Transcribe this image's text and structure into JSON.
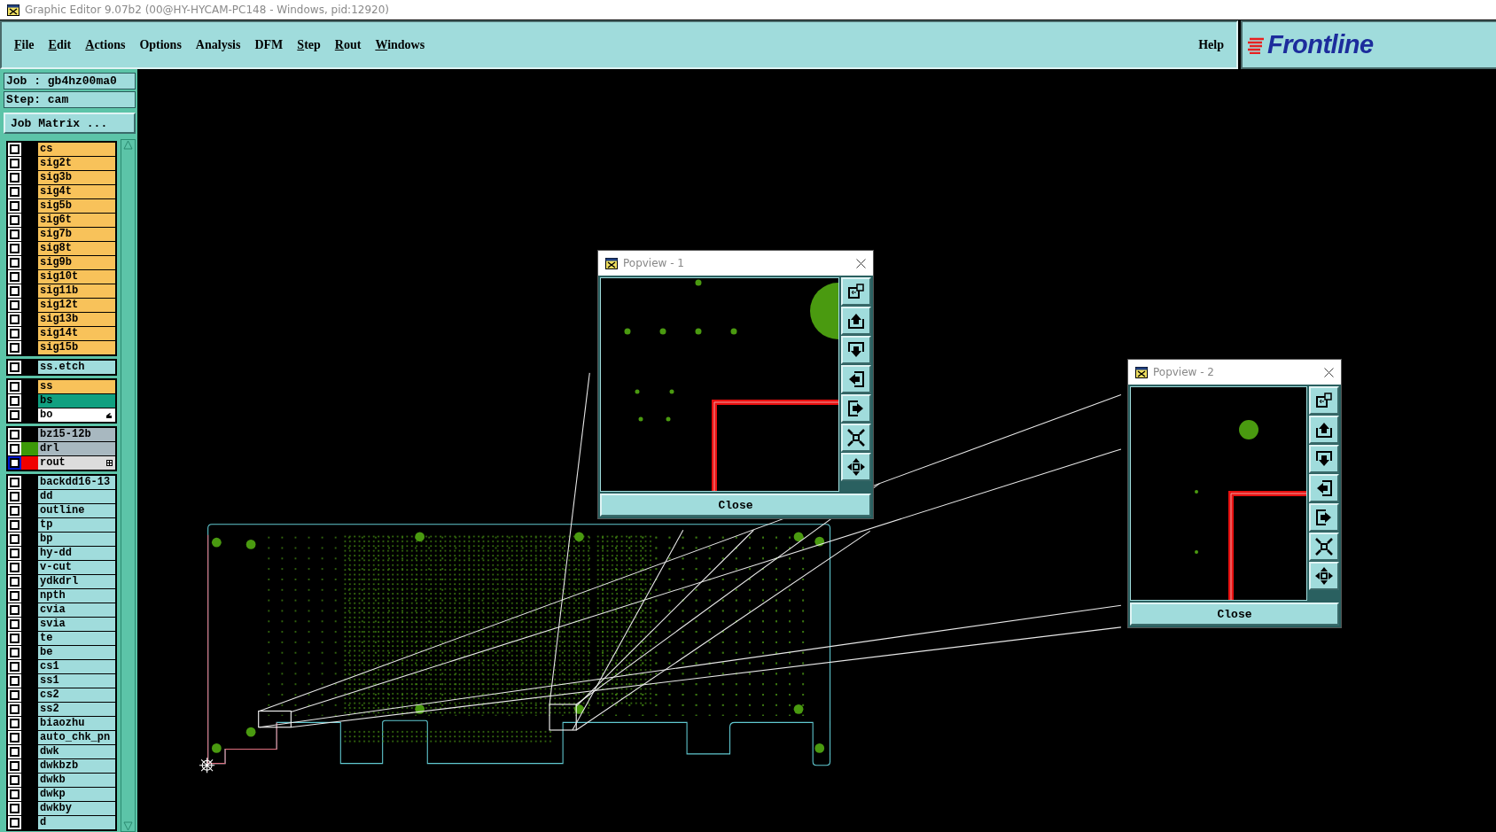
{
  "window": {
    "title": "Graphic Editor 9.07b2 (00@HY-HYCAM-PC148 - Windows, pid:12920)"
  },
  "menu": {
    "items": [
      {
        "label": "File",
        "mnemonic": true
      },
      {
        "label": "Edit",
        "mnemonic": true
      },
      {
        "label": "Actions",
        "mnemonic": true
      },
      {
        "label": "Options",
        "mnemonic": false
      },
      {
        "label": "Analysis",
        "mnemonic": false
      },
      {
        "label": "DFM",
        "mnemonic": false
      },
      {
        "label": "Step",
        "mnemonic": true
      },
      {
        "label": "Rout",
        "mnemonic": true
      },
      {
        "label": "Windows",
        "mnemonic": true
      }
    ],
    "help": "Help",
    "logo": "Frontline"
  },
  "job_panel": {
    "job": "Job : gb4hz00ma0",
    "step": "Step: cam",
    "matrix_button": "Job Matrix ..."
  },
  "layer_groups": [
    {
      "layers": [
        {
          "name": "cs",
          "color": "#f8c25a",
          "highlighted": false
        },
        {
          "name": "sig2t",
          "color": "#f8c25a",
          "highlighted": false
        },
        {
          "name": "sig3b",
          "color": "#f8c25a",
          "highlighted": false
        },
        {
          "name": "sig4t",
          "color": "#f8c25a",
          "highlighted": false
        },
        {
          "name": "sig5b",
          "color": "#f8c25a",
          "highlighted": false
        },
        {
          "name": "sig6t",
          "color": "#f8c25a",
          "highlighted": false
        },
        {
          "name": "sig7b",
          "color": "#f8c25a",
          "highlighted": false
        },
        {
          "name": "sig8t",
          "color": "#f8c25a",
          "highlighted": false
        },
        {
          "name": "sig9b",
          "color": "#f8c25a",
          "highlighted": false
        },
        {
          "name": "sig10t",
          "color": "#f8c25a",
          "highlighted": false
        },
        {
          "name": "sig11b",
          "color": "#f8c25a",
          "highlighted": false
        },
        {
          "name": "sig12t",
          "color": "#f8c25a",
          "highlighted": false
        },
        {
          "name": "sig13b",
          "color": "#f8c25a",
          "highlighted": false
        },
        {
          "name": "sig14t",
          "color": "#f8c25a",
          "highlighted": false
        },
        {
          "name": "sig15b",
          "color": "#f8c25a",
          "highlighted": false
        }
      ]
    },
    {
      "layers": [
        {
          "name": "ss.etch",
          "color": "#a0dcdc",
          "highlighted": false
        }
      ]
    },
    {
      "layers": [
        {
          "name": "ss",
          "color": "#f8c25a",
          "highlighted": false
        },
        {
          "name": "bs",
          "color": "#10a080",
          "highlighted": false
        },
        {
          "name": "bo",
          "color": "#ffffff",
          "highlighted": false,
          "indicator": {
            "kind": "hand"
          }
        }
      ]
    },
    {
      "layers": [
        {
          "name": "bz15-12b",
          "color": "#a8b8c0",
          "highlighted": false
        },
        {
          "name": "drl",
          "color": "#a8b8c0",
          "highlighted": false,
          "swatch": {
            "color": "#3c9a08"
          }
        },
        {
          "name": "rout",
          "color": "#dcdcdc",
          "highlighted": true,
          "swatch": {
            "color": "#f00000"
          },
          "indicator": {
            "kind": "grid"
          }
        }
      ]
    },
    {
      "layers": [
        {
          "name": "backdd16-13",
          "color": "#a0dcdc",
          "highlighted": false
        },
        {
          "name": "dd",
          "color": "#a0dcdc",
          "highlighted": false
        },
        {
          "name": "outline",
          "color": "#a0dcdc",
          "highlighted": false
        },
        {
          "name": "tp",
          "color": "#a0dcdc",
          "highlighted": false
        },
        {
          "name": "bp",
          "color": "#a0dcdc",
          "highlighted": false
        },
        {
          "name": "hy-dd",
          "color": "#a0dcdc",
          "highlighted": false
        },
        {
          "name": "v-cut",
          "color": "#a0dcdc",
          "highlighted": false
        },
        {
          "name": "ydkdrl",
          "color": "#a0dcdc",
          "highlighted": false
        },
        {
          "name": "npth",
          "color": "#a0dcdc",
          "highlighted": false
        },
        {
          "name": "cvia",
          "color": "#a0dcdc",
          "highlighted": false
        },
        {
          "name": "svia",
          "color": "#a0dcdc",
          "highlighted": false
        },
        {
          "name": "te",
          "color": "#a0dcdc",
          "highlighted": false
        },
        {
          "name": "be",
          "color": "#a0dcdc",
          "highlighted": false
        },
        {
          "name": "cs1",
          "color": "#a0dcdc",
          "highlighted": false
        },
        {
          "name": "ss1",
          "color": "#a0dcdc",
          "highlighted": false
        },
        {
          "name": "cs2",
          "color": "#a0dcdc",
          "highlighted": false
        },
        {
          "name": "ss2",
          "color": "#a0dcdc",
          "highlighted": false
        },
        {
          "name": "biaozhu",
          "color": "#a0dcdc",
          "highlighted": false
        },
        {
          "name": "auto_chk_pn",
          "color": "#a0dcdc",
          "highlighted": false
        },
        {
          "name": "dwk",
          "color": "#a0dcdc",
          "highlighted": false
        },
        {
          "name": "dwkbzb",
          "color": "#a0dcdc",
          "highlighted": false
        },
        {
          "name": "dwkb",
          "color": "#a0dcdc",
          "highlighted": false
        },
        {
          "name": "dwkp",
          "color": "#a0dcdc",
          "highlighted": false
        },
        {
          "name": "dwkby",
          "color": "#a0dcdc",
          "highlighted": false
        },
        {
          "name": "d",
          "color": "#a0dcdc",
          "highlighted": false
        }
      ]
    }
  ],
  "popviews": [
    {
      "title": "Popview - 1",
      "close": "Close"
    },
    {
      "title": "Popview - 2",
      "close": "Close"
    }
  ]
}
